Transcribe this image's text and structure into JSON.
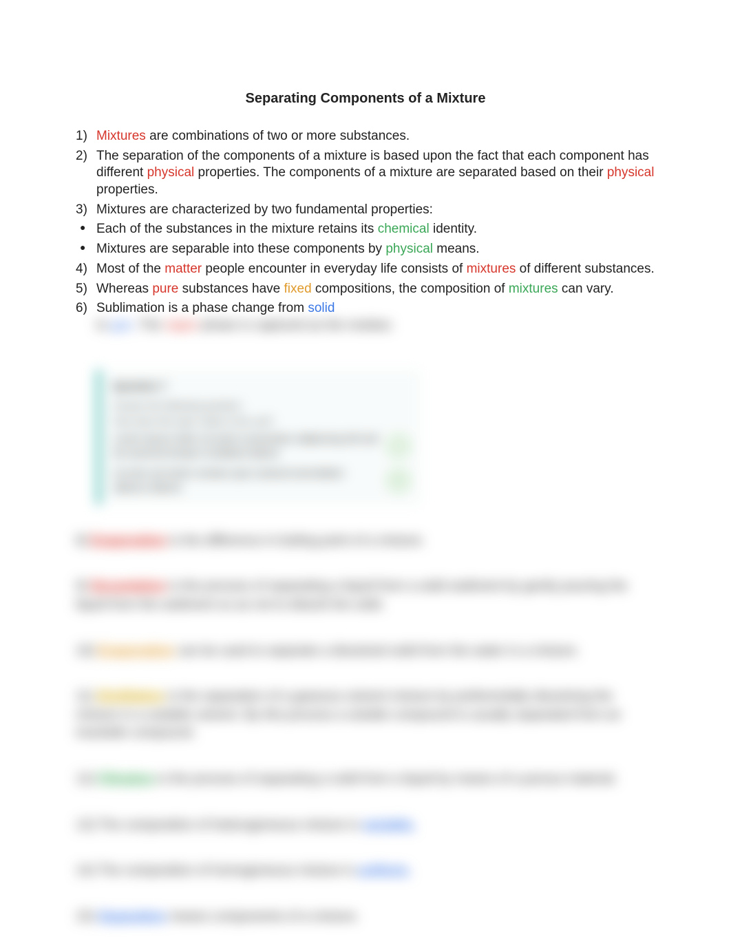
{
  "title": "Separating Components of a Mixture",
  "items": {
    "i1": {
      "w1": "Mixtures",
      "t1": " are combinations of two or more substances."
    },
    "i2": {
      "t1": "The separation of the components of a mixture is based upon the fact that each component has different ",
      "w1": "physical",
      "t2": " properties. The components of a mixture are separated based on their ",
      "w2": "physical",
      "t3": " properties."
    },
    "i3": {
      "t1": "Mixtures are characterized by two fundamental properties:"
    },
    "b1": {
      "t1": "Each of the substances in the mixture retains its ",
      "w1": "chemical",
      "t2": " identity."
    },
    "b2": {
      "t1": "Mixtures are separable into these components by ",
      "w1": "physical",
      "t2": " means."
    },
    "i4": {
      "t1": "Most of the ",
      "w1": "matter",
      "t2": " people encounter in everyday life consists of ",
      "w2": "mixtures",
      "t3": " of different substances."
    },
    "i5": {
      "t1": "Whereas ",
      "w1": "pure",
      "t2": " substances have ",
      "w2": "fixed",
      "t3": " compositions, the composition of ",
      "w3": "mixtures",
      "t4": " can vary."
    },
    "i6": {
      "t1": "Sublimation is a phase change from ",
      "w1": "solid",
      "t2": " to ",
      "w2": "gas",
      "t3": ". The ",
      "w3": "vapor",
      "t4": " phase is captured as the residue."
    }
  },
  "card": {
    "heading": "Question 7",
    "line1": "Answer the following question:",
    "line2": "How does this topic relate to the unit?",
    "rowA": "Lorem ipsum dolor sit amet consectetur adipiscing elit sed do eiusmod tempor incididunt labore",
    "rowB": "Ut enim ad minim veniam quis nostrud exercitation ullamco laboris",
    "badgeA": "A",
    "badgeB": "B"
  },
  "blurred": {
    "p8": {
      "n": "8) ",
      "w": "Evaporation",
      "t": " is the difference in boiling point of a mixture."
    },
    "p9": {
      "n": "9) ",
      "w": "Decantation",
      "t": " is the process of separating a liquid from a solid sediment by gently pouring the liquid from the sediment so as not to disturb the solid."
    },
    "p10": {
      "n": "10) ",
      "w": "Evaporation",
      "t": " can be used to separate a dissolved solid from the water in a mixture."
    },
    "p11": {
      "n": "11) ",
      "w": "Distillation",
      "t": " is the separation of a gaseous solvent mixture by preferentially dissolving the mixture in a suitable solvent. By this process a soluble compound is usually separated from an insoluble compound."
    },
    "p12": {
      "n": "12) ",
      "w": "Filtration",
      "t": " is the process of separating a solid from a liquid by means of a porous material."
    },
    "p13": {
      "n": "13) The composition of heterogeneous mixture is ",
      "w": "variable."
    },
    "p14": {
      "n": "14) The composition of homogeneous mixture is ",
      "w": "uniform."
    },
    "p15": {
      "n": "15) ",
      "w": "Separation",
      "t": " means components of a mixture."
    }
  }
}
